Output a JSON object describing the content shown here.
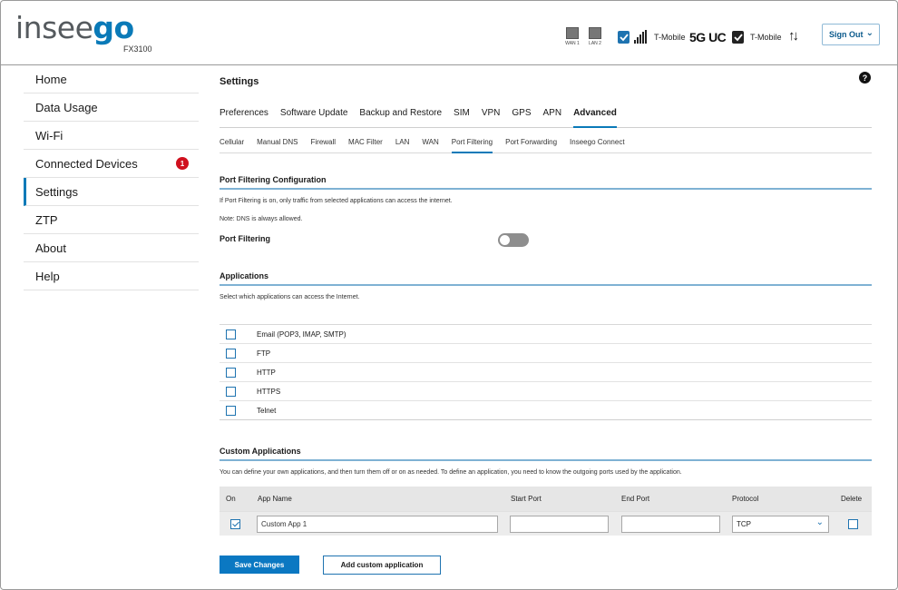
{
  "header": {
    "logo_text_a": "insee",
    "logo_text_b": "go",
    "model": "FX3100",
    "wan1": "WAN 1",
    "wan2": "LAN 2",
    "carrier1": "T-Mobile",
    "network": "5G UC",
    "carrier2": "T-Mobile",
    "data_arrows": "↑↓",
    "signout": "Sign Out"
  },
  "sidebar": {
    "items": [
      {
        "label": "Home"
      },
      {
        "label": "Data Usage"
      },
      {
        "label": "Wi-Fi"
      },
      {
        "label": "Connected Devices",
        "badge": "1"
      },
      {
        "label": "Settings"
      },
      {
        "label": "ZTP"
      },
      {
        "label": "About"
      },
      {
        "label": "Help"
      }
    ]
  },
  "main": {
    "title": "Settings",
    "help": "?",
    "tabs": [
      "Preferences",
      "Software Update",
      "Backup and Restore",
      "SIM",
      "VPN",
      "GPS",
      "APN",
      "Advanced"
    ],
    "subtabs": [
      "Cellular",
      "Manual DNS",
      "Firewall",
      "MAC Filter",
      "LAN",
      "WAN",
      "Port Filtering",
      "Port Forwarding",
      "Inseego Connect"
    ],
    "port_filtering": {
      "title": "Port Filtering Configuration",
      "desc": "If Port Filtering is on, only traffic from selected applications can access the internet.",
      "note": "Note: DNS is always allowed.",
      "toggle_label": "Port Filtering",
      "toggle_on": false
    },
    "applications": {
      "title": "Applications",
      "desc": "Select which applications can access the Internet.",
      "items": [
        "Email (POP3, IMAP, SMTP)",
        "FTP",
        "HTTP",
        "HTTPS",
        "Telnet"
      ]
    },
    "custom": {
      "title": "Custom Applications",
      "desc": "You can define your own applications, and then turn them off or on as needed. To define an application, you need to know the outgoing ports used by the application.",
      "columns": {
        "on": "On",
        "app_name": "App Name",
        "start_port": "Start Port",
        "end_port": "End Port",
        "protocol": "Protocol",
        "delete": "Delete"
      },
      "row": {
        "on": true,
        "app_name": "Custom App 1",
        "start_port": "",
        "end_port": "",
        "protocol": "TCP",
        "delete": false
      }
    },
    "save_button": "Save Changes",
    "add_button": "Add custom application"
  }
}
